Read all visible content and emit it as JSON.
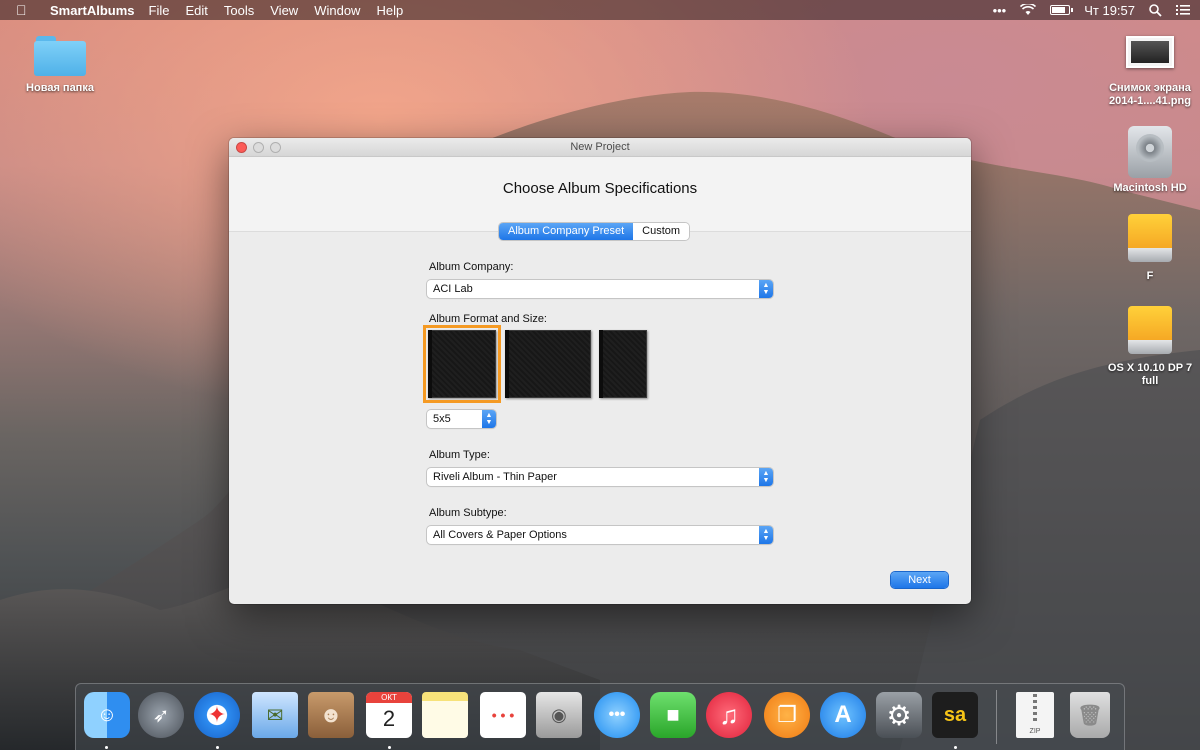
{
  "menubar": {
    "app_name": "SmartAlbums",
    "items": [
      "File",
      "Edit",
      "Tools",
      "View",
      "Window",
      "Help"
    ],
    "clock": "Чт 19:57",
    "dots": "•••"
  },
  "desktop": {
    "folder_label": "Новая папка",
    "screenshot_label_line1": "Снимок экрана",
    "screenshot_label_line2": "2014-1....41.png",
    "hdd_label": "Macintosh HD",
    "drive_f_label": "F",
    "osx_label_line1": "OS X 10.10 DP 7",
    "osx_label_line2": "full"
  },
  "window": {
    "title": "New Project",
    "heading": "Choose Album Specifications",
    "segments": {
      "preset": "Album Company Preset",
      "custom": "Custom",
      "selected": "preset"
    },
    "company_label": "Album Company:",
    "company_value": "ACI Lab",
    "format_label": "Album Format and Size:",
    "size_value": "5x5",
    "type_label": "Album Type:",
    "type_value": "Riveli Album - Thin Paper",
    "subtype_label": "Album Subtype:",
    "subtype_value": "All Covers & Paper Options",
    "next_label": "Next",
    "formats": [
      "square",
      "landscape",
      "portrait"
    ],
    "selected_format": "square",
    "selection_color": "#f59a23",
    "accent_color": "#1e76e8"
  },
  "dock": {
    "apps": [
      "Finder",
      "Launchpad",
      "Safari",
      "Mail",
      "Contacts",
      "Calendar",
      "Notes",
      "Reminders",
      "Photo Booth",
      "Messages",
      "FaceTime",
      "iTunes",
      "iBooks",
      "App Store",
      "System Preferences",
      "SmartAlbums"
    ],
    "calendar_month": "ОКТ",
    "calendar_day": "2",
    "smartalbums_glyph": "sa",
    "zip_label": "ZIP"
  }
}
